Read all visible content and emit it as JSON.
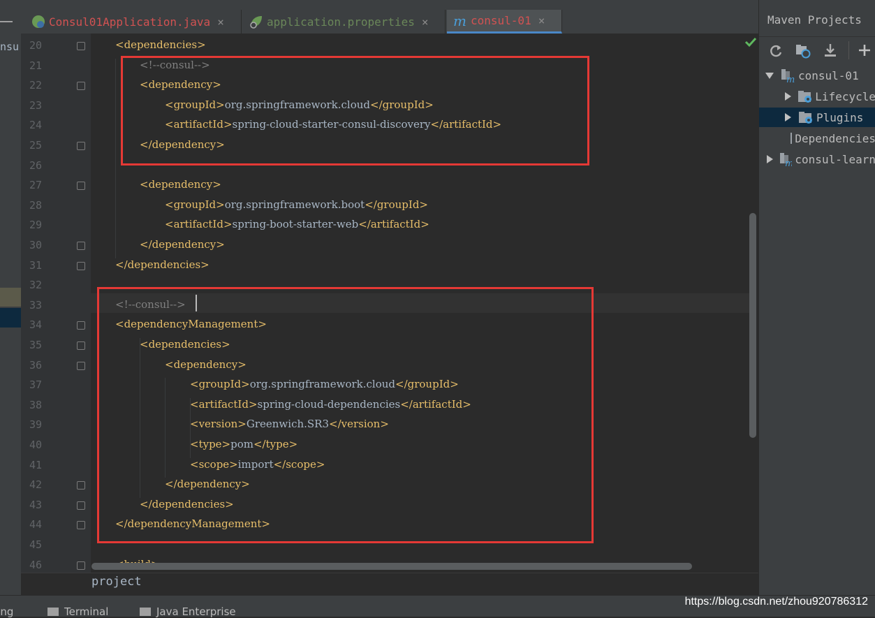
{
  "left_strip": {
    "label": "nsu"
  },
  "tabs": [
    {
      "label": "Consul01Application.java",
      "color": "#d25252",
      "icon": "spring-boot-run-icon",
      "active": false
    },
    {
      "label": "application.properties",
      "color": "#6a8759",
      "icon": "spring-leaf-icon",
      "active": false
    },
    {
      "label": "consul-01",
      "color": "#d25252",
      "icon": "maven-m-icon",
      "active": true
    }
  ],
  "tab_close_glyph": "×",
  "line_numbers": [
    "20",
    "21",
    "22",
    "23",
    "24",
    "25",
    "26",
    "27",
    "28",
    "29",
    "30",
    "31",
    "32",
    "33",
    "34",
    "35",
    "36",
    "37",
    "38",
    "39",
    "40",
    "41",
    "42",
    "43",
    "44",
    "45",
    "46"
  ],
  "code_lines": [
    [
      {
        "t": "t",
        "s": "<dependencies>"
      }
    ],
    [
      {
        "t": "c",
        "s": "<!--consul-->"
      }
    ],
    [
      {
        "t": "t",
        "s": "<dependency>"
      }
    ],
    [
      {
        "t": "t",
        "s": "<groupId>"
      },
      {
        "t": "x",
        "s": "org.springframework.cloud"
      },
      {
        "t": "t",
        "s": "</groupId>"
      }
    ],
    [
      {
        "t": "t",
        "s": "<artifactId>"
      },
      {
        "t": "x",
        "s": "spring-cloud-starter-consul-discovery"
      },
      {
        "t": "t",
        "s": "</artifactId>"
      }
    ],
    [
      {
        "t": "t",
        "s": "</dependency>"
      }
    ],
    [],
    [
      {
        "t": "t",
        "s": "<dependency>"
      }
    ],
    [
      {
        "t": "t",
        "s": "<groupId>"
      },
      {
        "t": "x",
        "s": "org.springframework.boot"
      },
      {
        "t": "t",
        "s": "</groupId>"
      }
    ],
    [
      {
        "t": "t",
        "s": "<artifactId>"
      },
      {
        "t": "x",
        "s": "spring-boot-starter-web"
      },
      {
        "t": "t",
        "s": "</artifactId>"
      }
    ],
    [
      {
        "t": "t",
        "s": "</dependency>"
      }
    ],
    [
      {
        "t": "t",
        "s": "</dependencies>"
      }
    ],
    [],
    [
      {
        "t": "c",
        "s": "<!--consul-->"
      }
    ],
    [
      {
        "t": "t",
        "s": "<dependencyManagement>"
      }
    ],
    [
      {
        "t": "t",
        "s": "<dependencies>"
      }
    ],
    [
      {
        "t": "t",
        "s": "<dependency>"
      }
    ],
    [
      {
        "t": "t",
        "s": "<groupId>"
      },
      {
        "t": "x",
        "s": "org.springframework.cloud"
      },
      {
        "t": "t",
        "s": "</groupId>"
      }
    ],
    [
      {
        "t": "t",
        "s": "<artifactId>"
      },
      {
        "t": "x",
        "s": "spring-cloud-dependencies"
      },
      {
        "t": "t",
        "s": "</artifactId>"
      }
    ],
    [
      {
        "t": "t",
        "s": "<version>"
      },
      {
        "t": "x",
        "s": "Greenwich.SR3"
      },
      {
        "t": "t",
        "s": "</version>"
      }
    ],
    [
      {
        "t": "t",
        "s": "<type>"
      },
      {
        "t": "x",
        "s": "pom"
      },
      {
        "t": "t",
        "s": "</type>"
      }
    ],
    [
      {
        "t": "t",
        "s": "<scope>"
      },
      {
        "t": "x",
        "s": "import"
      },
      {
        "t": "t",
        "s": "</scope>"
      }
    ],
    [
      {
        "t": "t",
        "s": "</dependency>"
      }
    ],
    [
      {
        "t": "t",
        "s": "</dependencies>"
      }
    ],
    [
      {
        "t": "t",
        "s": "</dependencyManagement>"
      }
    ],
    [],
    [
      {
        "t": "t",
        "s": "<build>"
      }
    ]
  ],
  "breadcrumb": "project",
  "maven_panel": {
    "title": "Maven Projects",
    "toolbar": [
      "refresh-icon",
      "reimport-icon",
      "download-icon",
      "add-icon"
    ],
    "tree": [
      {
        "label": "consul-01",
        "icon": "maven-module-icon",
        "expanded": true,
        "selected": false
      },
      {
        "label": "Lifecycle",
        "icon": "folder-gear-icon",
        "expanded": false,
        "selected": false
      },
      {
        "label": "Plugins",
        "icon": "folder-gear-icon",
        "expanded": false,
        "selected": true
      },
      {
        "label": "Dependencies",
        "icon": "dependencies-icon",
        "expanded": false,
        "selected": false
      },
      {
        "label": "consul-learn",
        "icon": "maven-module-icon",
        "expanded": false,
        "selected": false
      }
    ]
  },
  "status_bar": {
    "items": [
      {
        "label": "ring",
        "icon": ""
      },
      {
        "label": "Terminal",
        "icon": "terminal-icon"
      },
      {
        "label": "Java Enterprise",
        "icon": "java-enterprise-icon"
      }
    ],
    "watermark": "https://blog.csdn.net/zhou920786312"
  },
  "colors": {
    "tag": "#e8bf6a",
    "text": "#a9b7c6",
    "comment": "#808080",
    "highlight_box": "#e53935",
    "editor_bg": "#2b2b2b"
  }
}
